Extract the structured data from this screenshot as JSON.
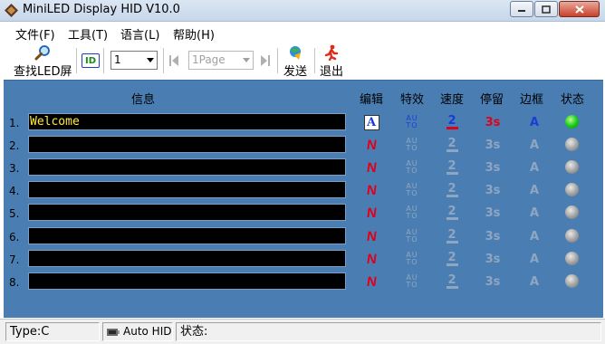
{
  "window": {
    "title": "MiniLED Display HID V10.0"
  },
  "menu": [
    "文件(F)",
    "工具(T)",
    "语言(L)",
    "帮助(H)"
  ],
  "toolbar": {
    "find_led": "查找LED屏",
    "id_label": "ID",
    "id_value": "1",
    "page_value": "1Page",
    "send": "发送",
    "exit": "退出"
  },
  "table": {
    "headers": {
      "info": "信息",
      "edit": "编辑",
      "effect": "特效",
      "speed": "速度",
      "stay": "停留",
      "border": "边框",
      "status": "状态"
    },
    "rows": [
      {
        "num": "1.",
        "message": "Welcome",
        "edit": "A",
        "effect": "AUTO",
        "speed": "2",
        "stay": "3s",
        "border": "A",
        "active": true
      },
      {
        "num": "2.",
        "message": "",
        "edit": "N",
        "effect": "AUTO",
        "speed": "2",
        "stay": "3s",
        "border": "A",
        "active": false
      },
      {
        "num": "3.",
        "message": "",
        "edit": "N",
        "effect": "AUTO",
        "speed": "2",
        "stay": "3s",
        "border": "A",
        "active": false
      },
      {
        "num": "4.",
        "message": "",
        "edit": "N",
        "effect": "AUTO",
        "speed": "2",
        "stay": "3s",
        "border": "A",
        "active": false
      },
      {
        "num": "5.",
        "message": "",
        "edit": "N",
        "effect": "AUTO",
        "speed": "2",
        "stay": "3s",
        "border": "A",
        "active": false
      },
      {
        "num": "6.",
        "message": "",
        "edit": "N",
        "effect": "AUTO",
        "speed": "2",
        "stay": "3s",
        "border": "A",
        "active": false
      },
      {
        "num": "7.",
        "message": "",
        "edit": "N",
        "effect": "AUTO",
        "speed": "2",
        "stay": "3s",
        "border": "A",
        "active": false
      },
      {
        "num": "8.",
        "message": "",
        "edit": "N",
        "effect": "AUTO",
        "speed": "2",
        "stay": "3s",
        "border": "A",
        "active": false
      }
    ]
  },
  "statusbar": {
    "type": "Type:C",
    "hid": "Auto HID",
    "status": "状态:"
  },
  "colors": {
    "panel": "#4a7eb3",
    "field": "#000000",
    "message_text": "#ffeb3b",
    "active_dot": "#14c814",
    "edit_red": "#e0001a",
    "icon_blue": "#1a3cd6"
  }
}
